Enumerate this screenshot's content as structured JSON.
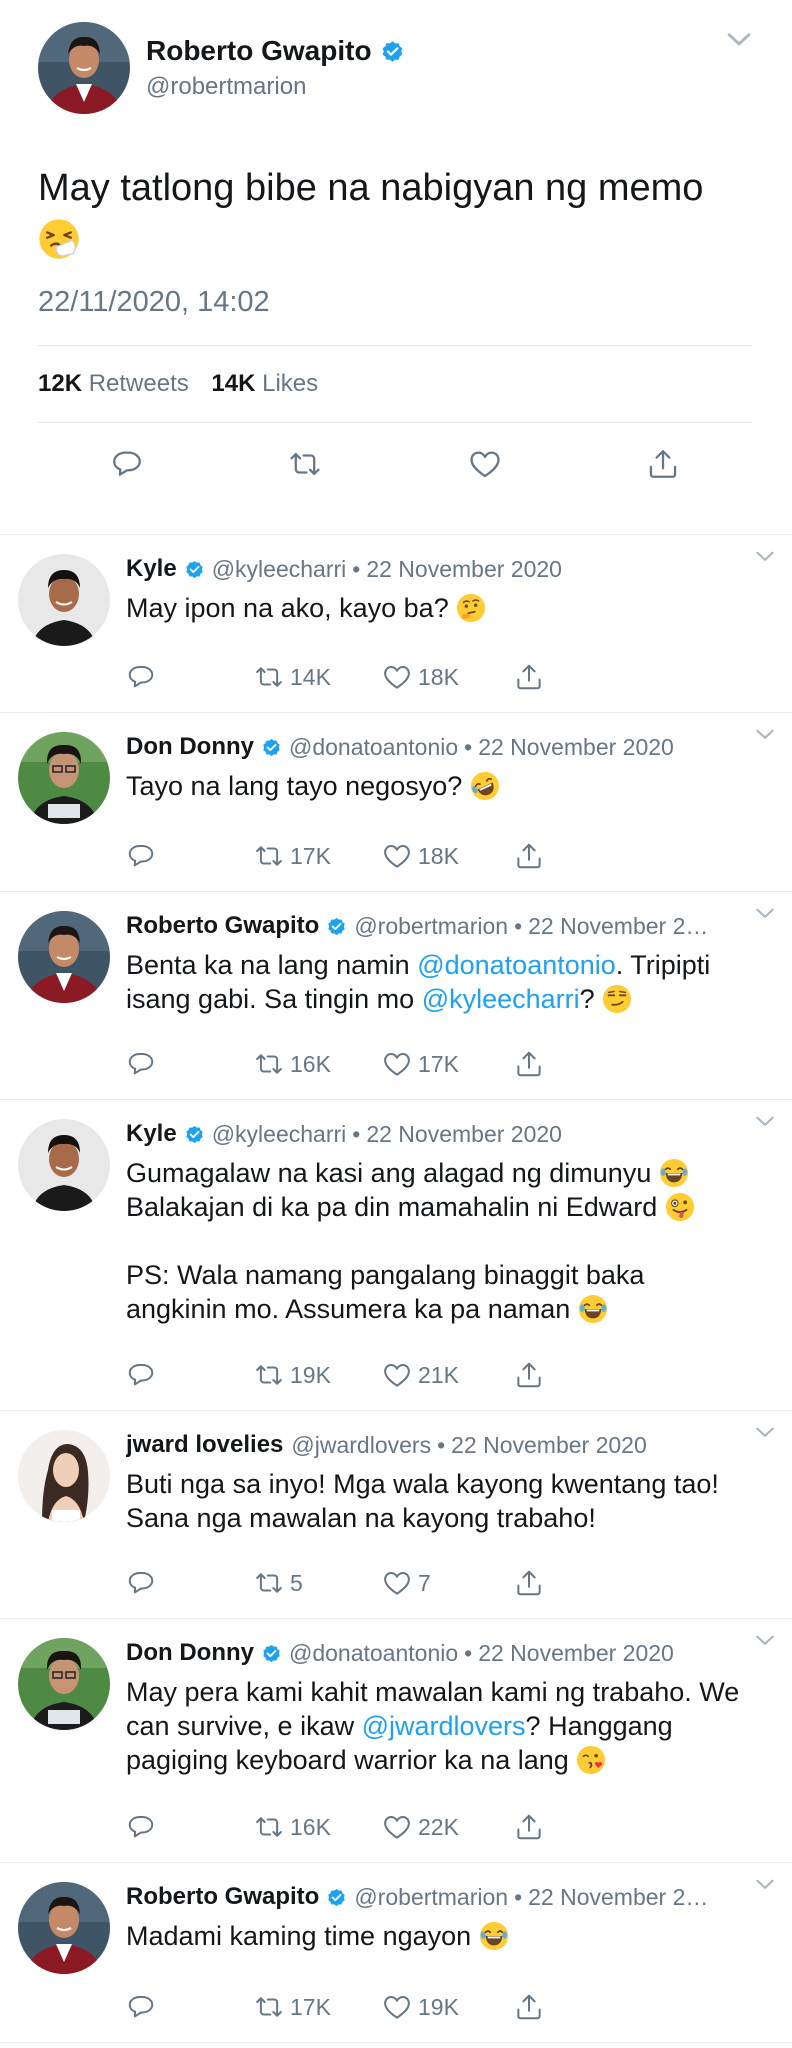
{
  "main_tweet": {
    "name": "Roberto Gwapito",
    "handle": "@robertmarion",
    "text": "May tatlong bibe na nabigyan ng memo",
    "emoji": "sneezing-face",
    "timestamp": "22/11/2020, 14:02",
    "retweets_count": "12K",
    "retweets_label": "Retweets",
    "likes_count": "14K",
    "likes_label": "Likes"
  },
  "replies": [
    {
      "name": "Kyle",
      "handle": "@kyleecharri",
      "separator": "•",
      "date": "22 November 2020",
      "text_parts": [
        "May ipon na ako, kayo ba? "
      ],
      "emojis": [
        "thinking-face"
      ],
      "retweets": "14K",
      "likes": "18K"
    },
    {
      "name": "Don Donny",
      "handle": "@donatoantonio",
      "separator": "•",
      "date": "22 November 2020",
      "text_parts": [
        "Tayo na lang tayo negosyo? "
      ],
      "emojis": [
        "rolling-on-floor-laughing"
      ],
      "retweets": "17K",
      "likes": "18K"
    },
    {
      "name": "Roberto Gwapito",
      "handle": "@robertmarion",
      "separator": "•",
      "date": "22 November 2…",
      "text_before": "Benta ka na lang namin ",
      "mention1": "@donatoantonio",
      "text_middle": ". Tripipti isang gabi. Sa tingin mo ",
      "mention2": "@kyleecharri",
      "text_after": "? ",
      "emojis": [
        "smirking-face"
      ],
      "retweets": "16K",
      "likes": "17K"
    },
    {
      "name": "Kyle",
      "handle": "@kyleecharri",
      "separator": "•",
      "date": "22 November 2020",
      "line1": "Gumagalaw na kasi ang alagad ng dimunyu ",
      "line2": "Balakajan di ka pa din mamahalin ni Edward ",
      "line3": "PS: Wala namang pangalang binaggit baka angkinin mo. Assumera ka pa naman ",
      "emojis": [
        "face-with-tears-of-joy",
        "zany-face",
        "face-with-tears-of-joy"
      ],
      "retweets": "19K",
      "likes": "21K"
    },
    {
      "name": "jward lovelies",
      "handle": "@jwardlovers",
      "separator": "•",
      "date": "22 November 2020",
      "text": "Buti nga sa inyo! Mga wala kayong kwentang tao! Sana nga mawalan na kayong trabaho!",
      "retweets": "5",
      "likes": "7"
    },
    {
      "name": "Don Donny",
      "handle": "@donatoantonio",
      "separator": "•",
      "date": "22 November 2020",
      "text_before": "May pera kami kahit mawalan kami ng trabaho. We can survive, e ikaw ",
      "mention": "@jwardlovers",
      "text_after": "? Hanggang pagiging keyboard warrior ka na lang ",
      "emojis": [
        "face-blowing-a-kiss"
      ],
      "retweets": "16K",
      "likes": "22K"
    },
    {
      "name": "Roberto Gwapito",
      "handle": "@robertmarion",
      "separator": "•",
      "date": "22 November 2…",
      "text": "Madami kaming time ngayon ",
      "emojis": [
        "face-with-tears-of-joy"
      ],
      "retweets": "17K",
      "likes": "19K"
    }
  ],
  "colors": {
    "verified": "#1da1f2",
    "mention": "#1da1f2",
    "text": "#14171a",
    "secondary": "#657786",
    "divider": "#e6ecf0"
  },
  "icons": {
    "reply": "reply-icon",
    "retweet": "retweet-icon",
    "like": "heart-icon",
    "share": "share-icon",
    "menu": "chevron-down-icon",
    "verified": "verified-badge-icon"
  }
}
